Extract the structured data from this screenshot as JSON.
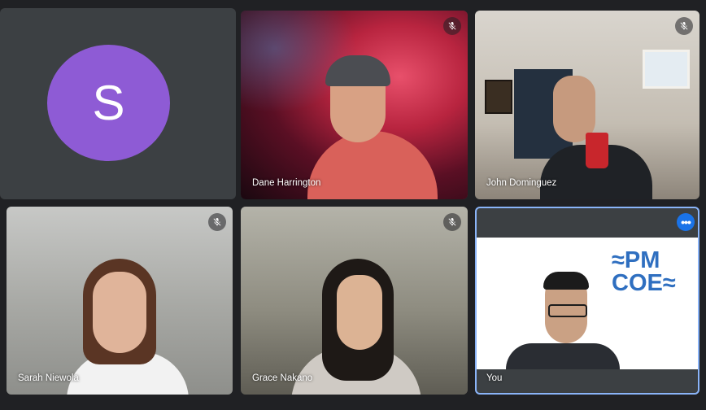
{
  "participants": [
    {
      "name": "",
      "avatar_letter": "S",
      "avatar_color": "#8e5bd5",
      "muted": false
    },
    {
      "name": "Dane Harrington",
      "muted": true
    },
    {
      "name": "John Dominguez",
      "muted": true
    },
    {
      "name": "Sarah Niewola",
      "muted": true
    },
    {
      "name": "Grace Nakano",
      "muted": true
    },
    {
      "name": "You",
      "muted": false,
      "more_options": true
    }
  ],
  "logo": {
    "line1": "≈PM",
    "line2": "COE≈",
    "color": "#2f6fc0"
  },
  "colors": {
    "background": "#202124",
    "active_border": "#8ab4f8",
    "more_button": "#1a73e8"
  }
}
